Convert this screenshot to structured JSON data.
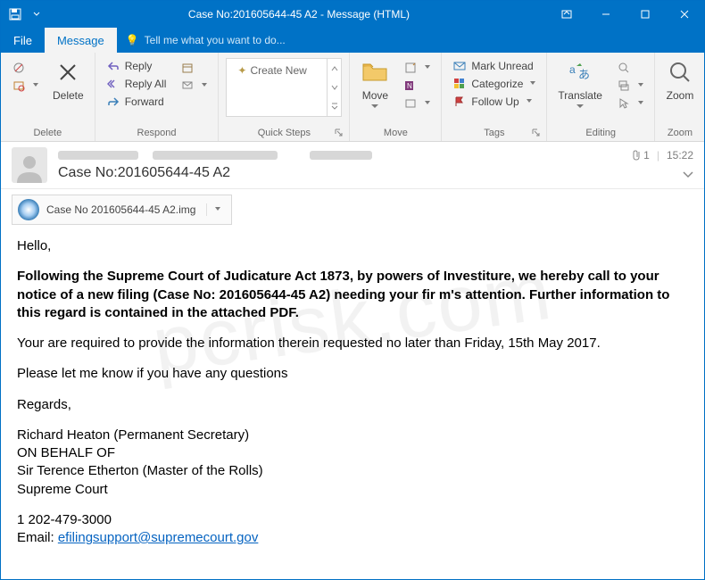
{
  "window": {
    "title": "Case No:201605644-45 A2 - Message (HTML)"
  },
  "tabs": {
    "file": "File",
    "message": "Message",
    "tellme": "Tell me what you want to do..."
  },
  "ribbon": {
    "delete": {
      "btn": "Delete",
      "group": "Delete"
    },
    "respond": {
      "reply": "Reply",
      "reply_all": "Reply All",
      "forward": "Forward",
      "group": "Respond"
    },
    "quicksteps": {
      "create": "Create New",
      "group": "Quick Steps"
    },
    "move": {
      "btn": "Move",
      "group": "Move"
    },
    "tags": {
      "unread": "Mark Unread",
      "categorize": "Categorize",
      "followup": "Follow Up",
      "group": "Tags"
    },
    "editing": {
      "translate": "Translate",
      "group": "Editing"
    },
    "zoom": {
      "btn": "Zoom",
      "group": "Zoom"
    }
  },
  "message": {
    "subject": "Case No:201605644-45 A2",
    "time": "15:22",
    "attach_count": "1",
    "attachment": "Case No 201605644-45 A2.img"
  },
  "body": {
    "greeting": "Hello,",
    "p1": "Following the Supreme Court of Judicature Act 1873, by powers of Investiture, we hereby call to your notice of a new filing (Case No: 201605644-45 A2) needing your fir m's attention. Further information to this regard is contained in the attached PDF.",
    "p2": "Your are required to provide the information therein requested no later than Friday, 15th May 2017.",
    "p3": "Please let me know if you have any questions",
    "regards": "Regards,",
    "sig1": "Richard Heaton (Permanent Secretary)",
    "sig2": "ON BEHALF OF",
    "sig3": "Sir Terence Etherton (Master of the Rolls)",
    "sig4": "Supreme Court",
    "phone": "1 202-479-3000",
    "email_label": "Email: ",
    "email": "efilingsupport@supremecourt.gov"
  },
  "watermark": "pcrisk.com"
}
